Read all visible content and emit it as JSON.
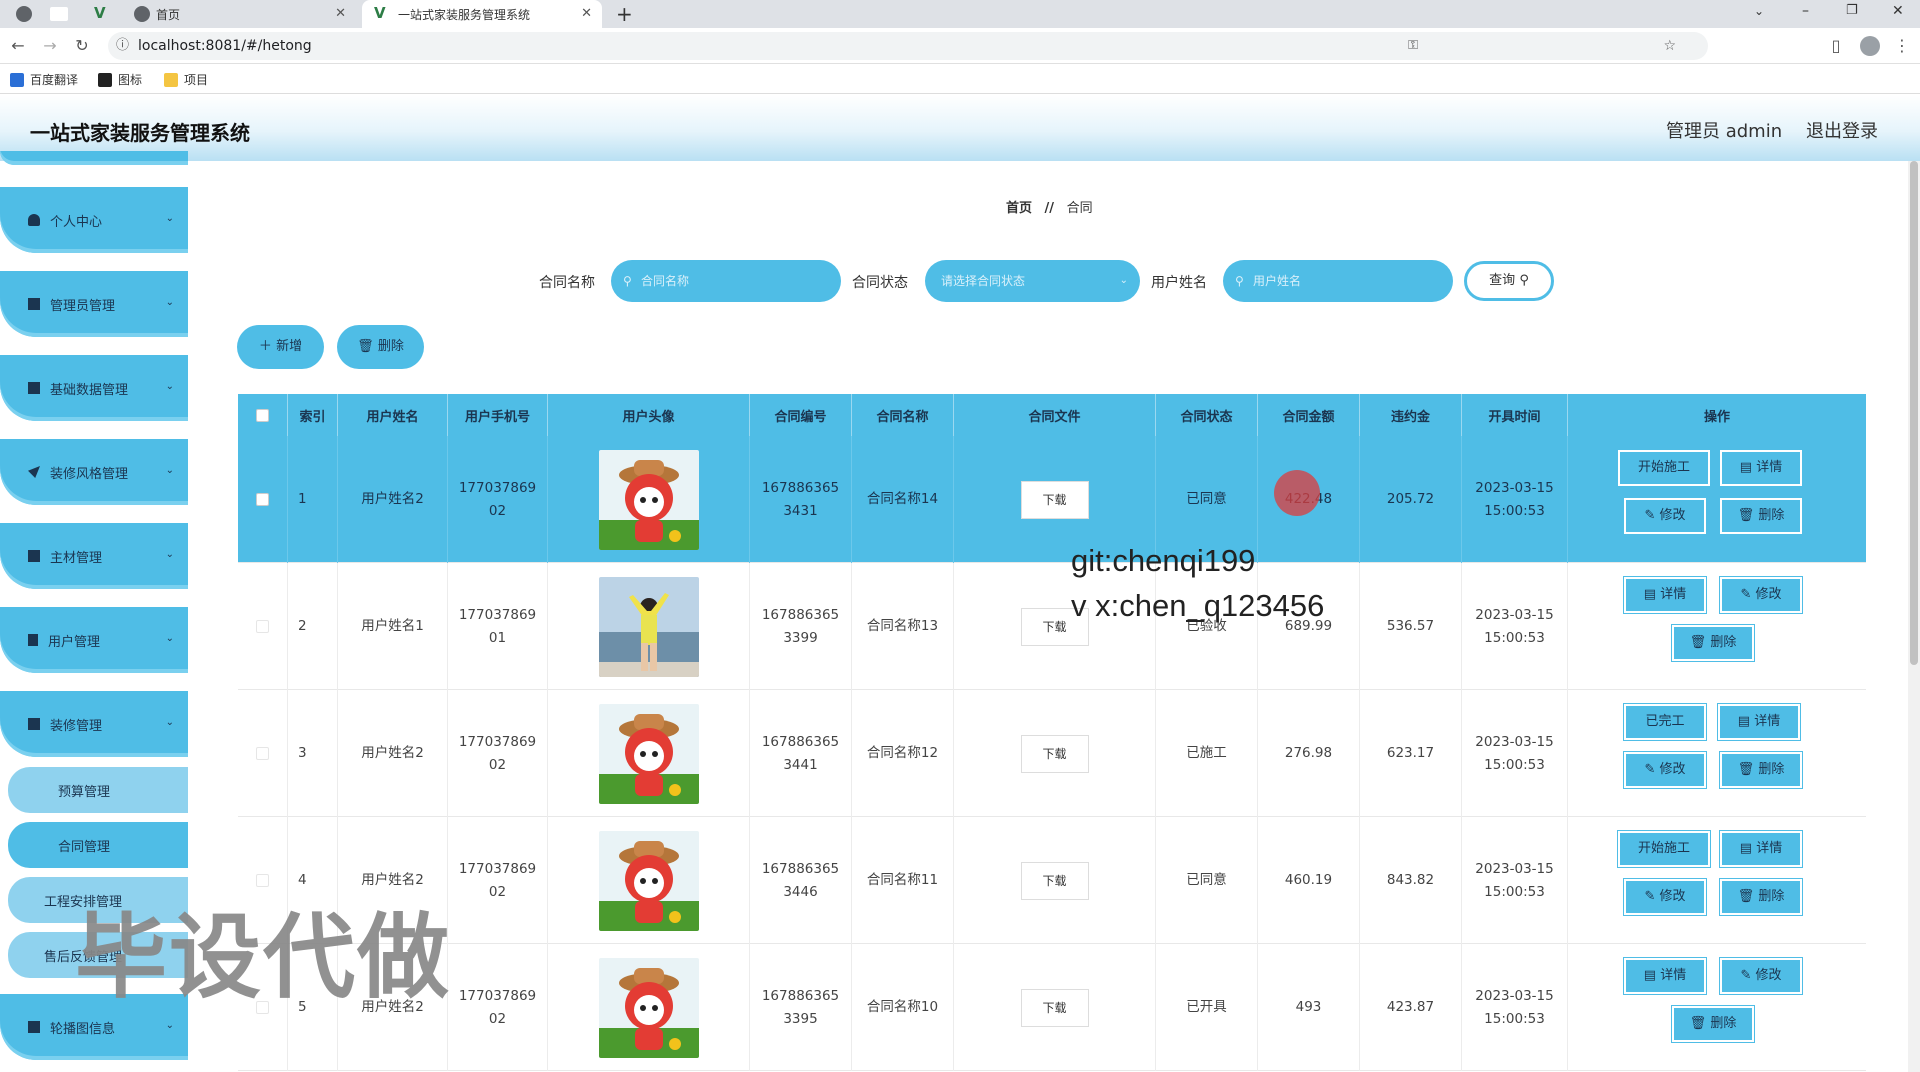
{
  "browser": {
    "tabs": [
      {
        "title": "首页"
      },
      {
        "title": "一站式家装服务管理系统"
      }
    ],
    "new_tab": "+",
    "url": "localhost:8081/#/hetong",
    "bookmarks": [
      "百度翻译",
      "图标",
      "项目"
    ]
  },
  "app": {
    "title": "一站式家装服务管理系统",
    "user": "管理员 admin",
    "logout": "退出登录"
  },
  "sidebar": {
    "menus": [
      {
        "label": "个人中心",
        "icon": "user-icon"
      },
      {
        "label": "管理员管理",
        "icon": "grid-icon"
      },
      {
        "label": "基础数据管理",
        "icon": "grid-icon"
      },
      {
        "label": "装修风格管理",
        "icon": "send-icon"
      },
      {
        "label": "主材管理",
        "icon": "grid-icon"
      },
      {
        "label": "用户管理",
        "icon": "trash-icon"
      },
      {
        "label": "装修管理",
        "icon": "grid-icon"
      }
    ],
    "submenus": [
      "预算管理",
      "合同管理",
      "工程安排管理",
      "售后反馈管理"
    ],
    "last_menu": {
      "label": "轮播图信息",
      "icon": "grid-icon"
    }
  },
  "breadcrumb": {
    "home": "首页",
    "sep": "//",
    "current": "合同"
  },
  "search": {
    "name_label": "合同名称",
    "name_placeholder": "合同名称",
    "status_label": "合同状态",
    "status_placeholder": "请选择合同状态",
    "user_label": "用户姓名",
    "user_placeholder": "用户姓名",
    "query_label": "查询"
  },
  "actions": {
    "add": "新增",
    "delete": "删除"
  },
  "table": {
    "headers": [
      "索引",
      "用户姓名",
      "用户手机号",
      "用户头像",
      "合同编号",
      "合同名称",
      "合同文件",
      "合同状态",
      "合同金额",
      "违约金",
      "开具时间",
      "操作"
    ],
    "download_label": "下载",
    "rows": [
      {
        "index": "1",
        "user": "用户姓名2",
        "phone1": "177037869",
        "phone2": "02",
        "avatar": "cartoon",
        "no1": "167886365",
        "no2": "3431",
        "name": "合同名称14",
        "status": "已同意",
        "amount": "422.48",
        "penalty": "205.72",
        "date": "2023-03-15",
        "time": "15:00:53",
        "ops": [
          "开始施工",
          "详情",
          "修改",
          "删除"
        ]
      },
      {
        "index": "2",
        "user": "用户姓名1",
        "phone1": "177037869",
        "phone2": "01",
        "avatar": "photo",
        "no1": "167886365",
        "no2": "3399",
        "name": "合同名称13",
        "status": "已验收",
        "amount": "689.99",
        "penalty": "536.57",
        "date": "2023-03-15",
        "time": "15:00:53",
        "ops": [
          "详情",
          "修改",
          "删除"
        ]
      },
      {
        "index": "3",
        "user": "用户姓名2",
        "phone1": "177037869",
        "phone2": "02",
        "avatar": "cartoon",
        "no1": "167886365",
        "no2": "3441",
        "name": "合同名称12",
        "status": "已施工",
        "amount": "276.98",
        "penalty": "623.17",
        "date": "2023-03-15",
        "time": "15:00:53",
        "ops": [
          "已完工",
          "详情",
          "修改",
          "删除"
        ]
      },
      {
        "index": "4",
        "user": "用户姓名2",
        "phone1": "177037869",
        "phone2": "02",
        "avatar": "cartoon",
        "no1": "167886365",
        "no2": "3446",
        "name": "合同名称11",
        "status": "已同意",
        "amount": "460.19",
        "penalty": "843.82",
        "date": "2023-03-15",
        "time": "15:00:53",
        "ops": [
          "开始施工",
          "详情",
          "修改",
          "删除"
        ]
      },
      {
        "index": "5",
        "user": "用户姓名2",
        "phone1": "177037869",
        "phone2": "02",
        "avatar": "cartoon",
        "no1": "167886365",
        "no2": "3395",
        "name": "合同名称10",
        "status": "已开具",
        "amount": "493",
        "penalty": "423.87",
        "date": "2023-03-15",
        "time": "15:00:53",
        "ops": [
          "详情",
          "修改",
          "删除"
        ]
      }
    ]
  },
  "watermark": {
    "line1": "git:chenqi199",
    "line2": "v x:chen_q123456",
    "big": "毕设代做"
  },
  "colors": {
    "primary": "#4fbde6",
    "text_dark": "#1b3550"
  }
}
